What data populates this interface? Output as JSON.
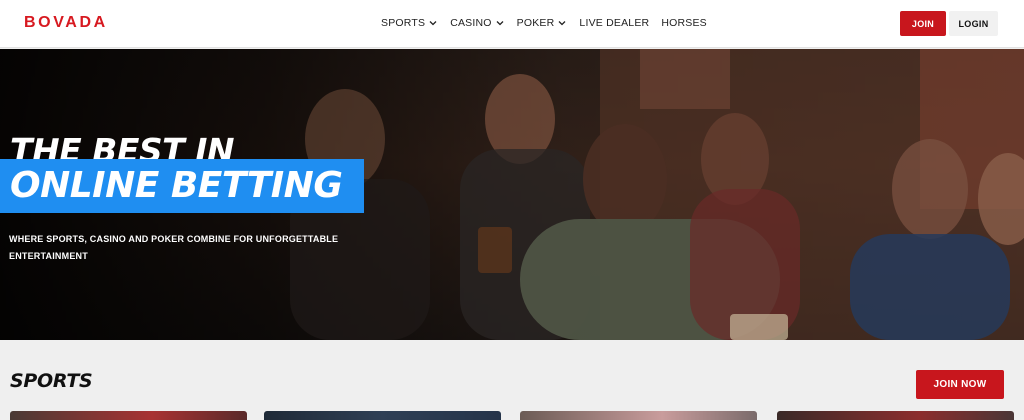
{
  "header": {
    "logo_text": "BOVADA",
    "nav": [
      {
        "label": "SPORTS",
        "has_dropdown": true
      },
      {
        "label": "CASINO",
        "has_dropdown": true
      },
      {
        "label": "POKER",
        "has_dropdown": true
      },
      {
        "label": "LIVE DEALER",
        "has_dropdown": false
      },
      {
        "label": "HORSES",
        "has_dropdown": false
      }
    ],
    "join_label": "JOIN",
    "login_label": "LOGIN"
  },
  "hero": {
    "title_line1": "THE BEST IN",
    "title_line2": "ONLINE BETTING",
    "subtitle": "WHERE SPORTS, CASINO AND POKER COMBINE FOR UNFORGETTABLE ENTERTAINMENT"
  },
  "sports": {
    "title": "SPORTS",
    "join_now_label": "JOIN NOW"
  },
  "colors": {
    "brand_red": "#c8161d",
    "logo_red": "#d71920",
    "accent_blue": "#1f8ef1"
  },
  "icons": {
    "dropdown": "chevron-down-icon"
  }
}
